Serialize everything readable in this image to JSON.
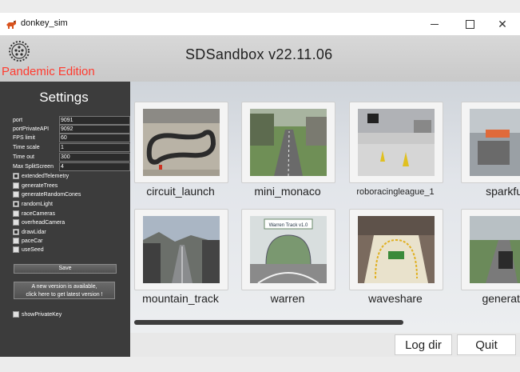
{
  "window": {
    "title": "donkey_sim",
    "minimize_icon": "minimize-icon",
    "maximize_icon": "maximize-icon",
    "close_glyph": "✕"
  },
  "header": {
    "title": "SDSandbox v22.11.06",
    "edition": "Pandemic Edition",
    "edition_color": "#ff3b2f",
    "logo_icon": "gear-logo-icon"
  },
  "settings": {
    "title": "Settings",
    "fields": [
      {
        "label": "port",
        "value": "9091"
      },
      {
        "label": "portPrivateAPI",
        "value": "9092"
      },
      {
        "label": "FPS limit",
        "value": "60"
      },
      {
        "label": "Time scale",
        "value": "1"
      },
      {
        "label": "Time out",
        "value": "300"
      },
      {
        "label": "Max SplitScreen",
        "value": "4"
      }
    ],
    "checkboxes": [
      {
        "label": "extendedTelemetry",
        "checked": true
      },
      {
        "label": "generateTrees",
        "checked": false
      },
      {
        "label": "generateRandomCones",
        "checked": false
      },
      {
        "label": "randomLight",
        "checked": true
      },
      {
        "label": "raceCameras",
        "checked": false
      },
      {
        "label": "overheadCamera",
        "checked": false
      },
      {
        "label": "drawLidar",
        "checked": true
      },
      {
        "label": "paceCar",
        "checked": false
      },
      {
        "label": "useSeed",
        "checked": false
      }
    ],
    "save_label": "Save",
    "update_line1": "A new version is available,",
    "update_line2": "click here to get latest version !",
    "show_private_key": {
      "label": "showPrivateKey",
      "checked": false
    }
  },
  "tracks": [
    {
      "name": "circuit_launch"
    },
    {
      "name": "mini_monaco"
    },
    {
      "name": "roboracingleague_1"
    },
    {
      "name": "sparkfun"
    },
    {
      "name": "mountain_track"
    },
    {
      "name": "warren"
    },
    {
      "name": "waveshare"
    },
    {
      "name": "generated"
    }
  ],
  "warren_sign": "Warren Track v1.0",
  "buttons": {
    "log_dir": "Log dir",
    "quit": "Quit"
  }
}
